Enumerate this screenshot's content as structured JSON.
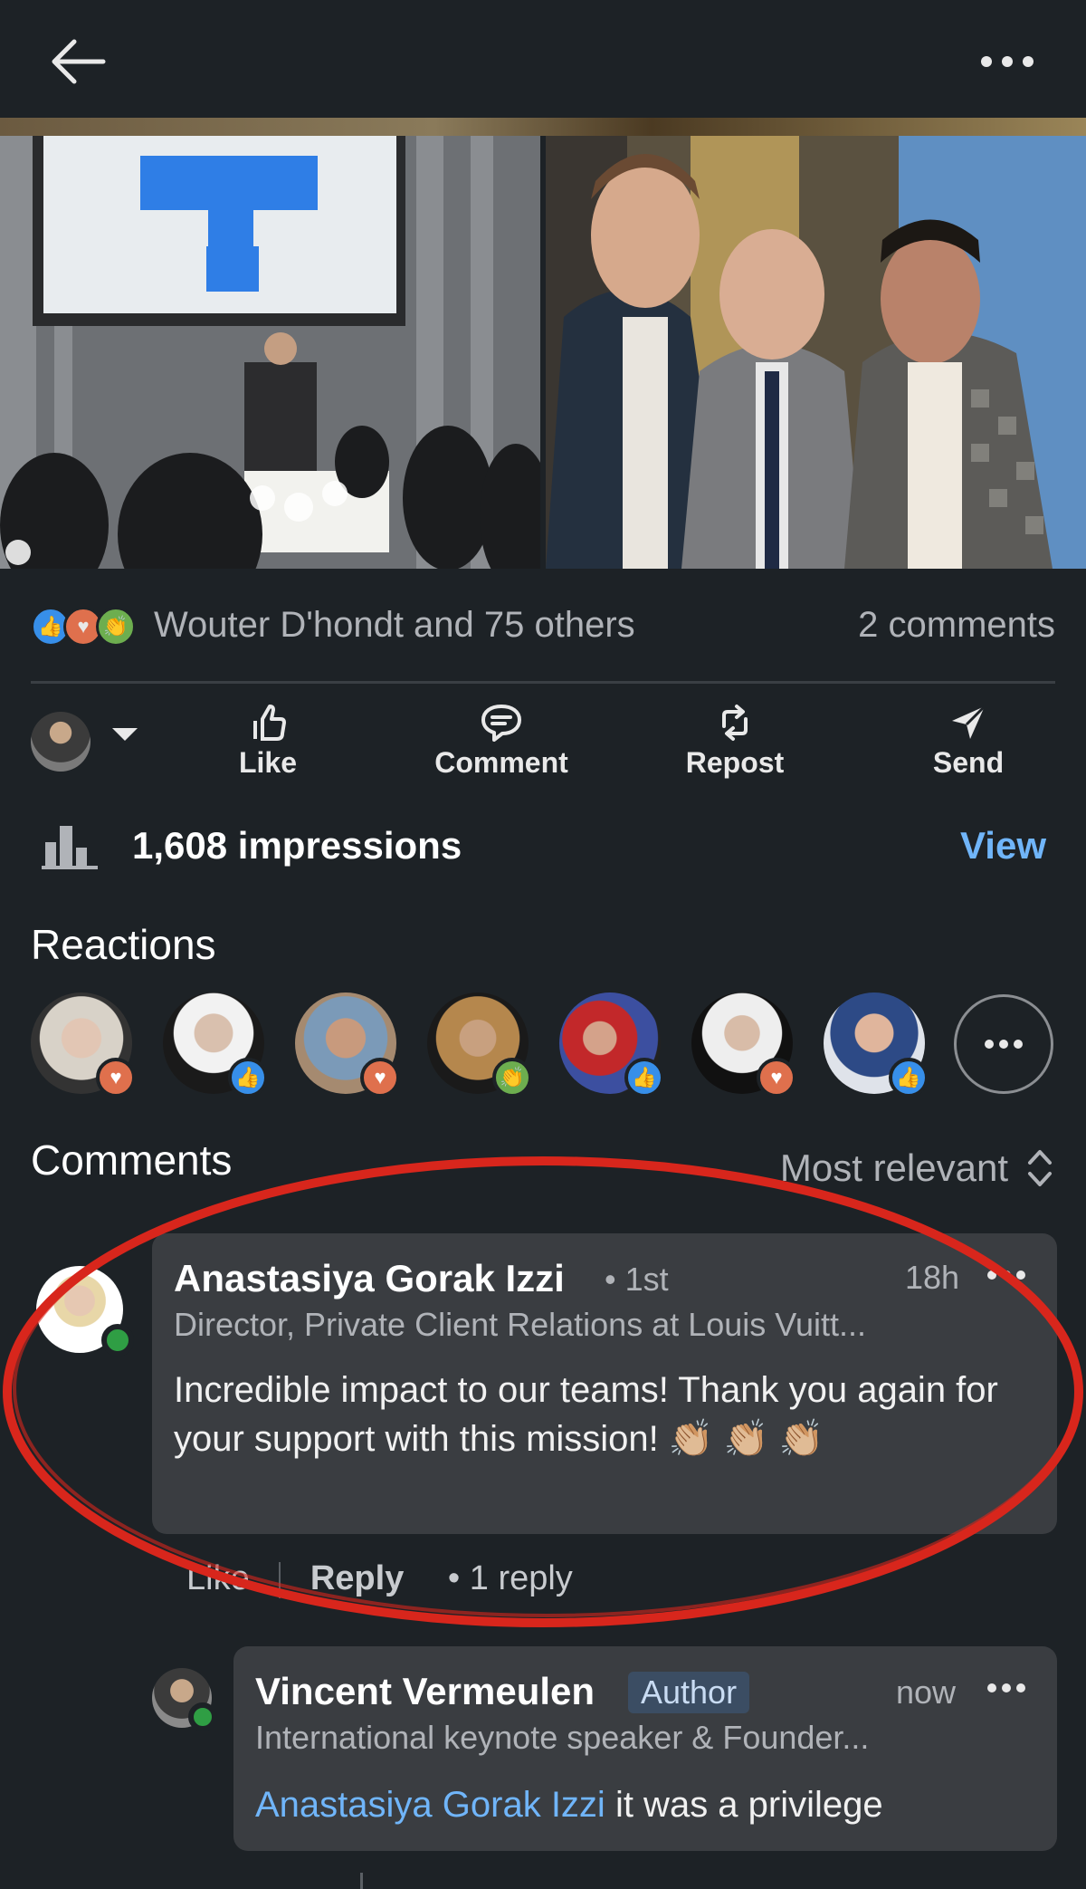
{
  "header": {
    "back_icon": "arrow-left-icon",
    "more_icon": "more-horizontal-icon"
  },
  "post": {
    "reactions_summary": "Wouter D'hondt and 75 others",
    "comments_count": "2 comments",
    "reaction_types": [
      "like",
      "love",
      "celebrate"
    ]
  },
  "actions": {
    "like": "Like",
    "comment": "Comment",
    "repost": "Repost",
    "send": "Send"
  },
  "impressions": {
    "text": "1,608 impressions",
    "view": "View"
  },
  "reactions_section": {
    "title": "Reactions",
    "reactors": [
      "love",
      "like",
      "love",
      "celebrate",
      "like",
      "love",
      "like"
    ]
  },
  "comments_section": {
    "title": "Comments",
    "sort": "Most relevant"
  },
  "comments": [
    {
      "name": "Anastasiya Gorak Izzi",
      "degree": "• 1st",
      "time": "18h",
      "headline": "Director, Private Client Relations at Louis Vuitt...",
      "text": "Incredible impact to our teams! Thank you again for your support with this mission! 👏🏼 👏🏼 👏🏼",
      "like": "Like",
      "reply": "Reply",
      "replies": "• 1 reply"
    }
  ],
  "reply": {
    "name": "Vincent Vermeulen",
    "badge": "Author",
    "time": "now",
    "headline": "International keynote speaker & Founder...",
    "mention": "Anastasiya Gorak Izzi",
    "text": " it was a privilege"
  },
  "colors": {
    "background": "#1d2226",
    "link": "#70b5f9",
    "bubble": "#3a3d41",
    "annotation": "#d8261c"
  }
}
